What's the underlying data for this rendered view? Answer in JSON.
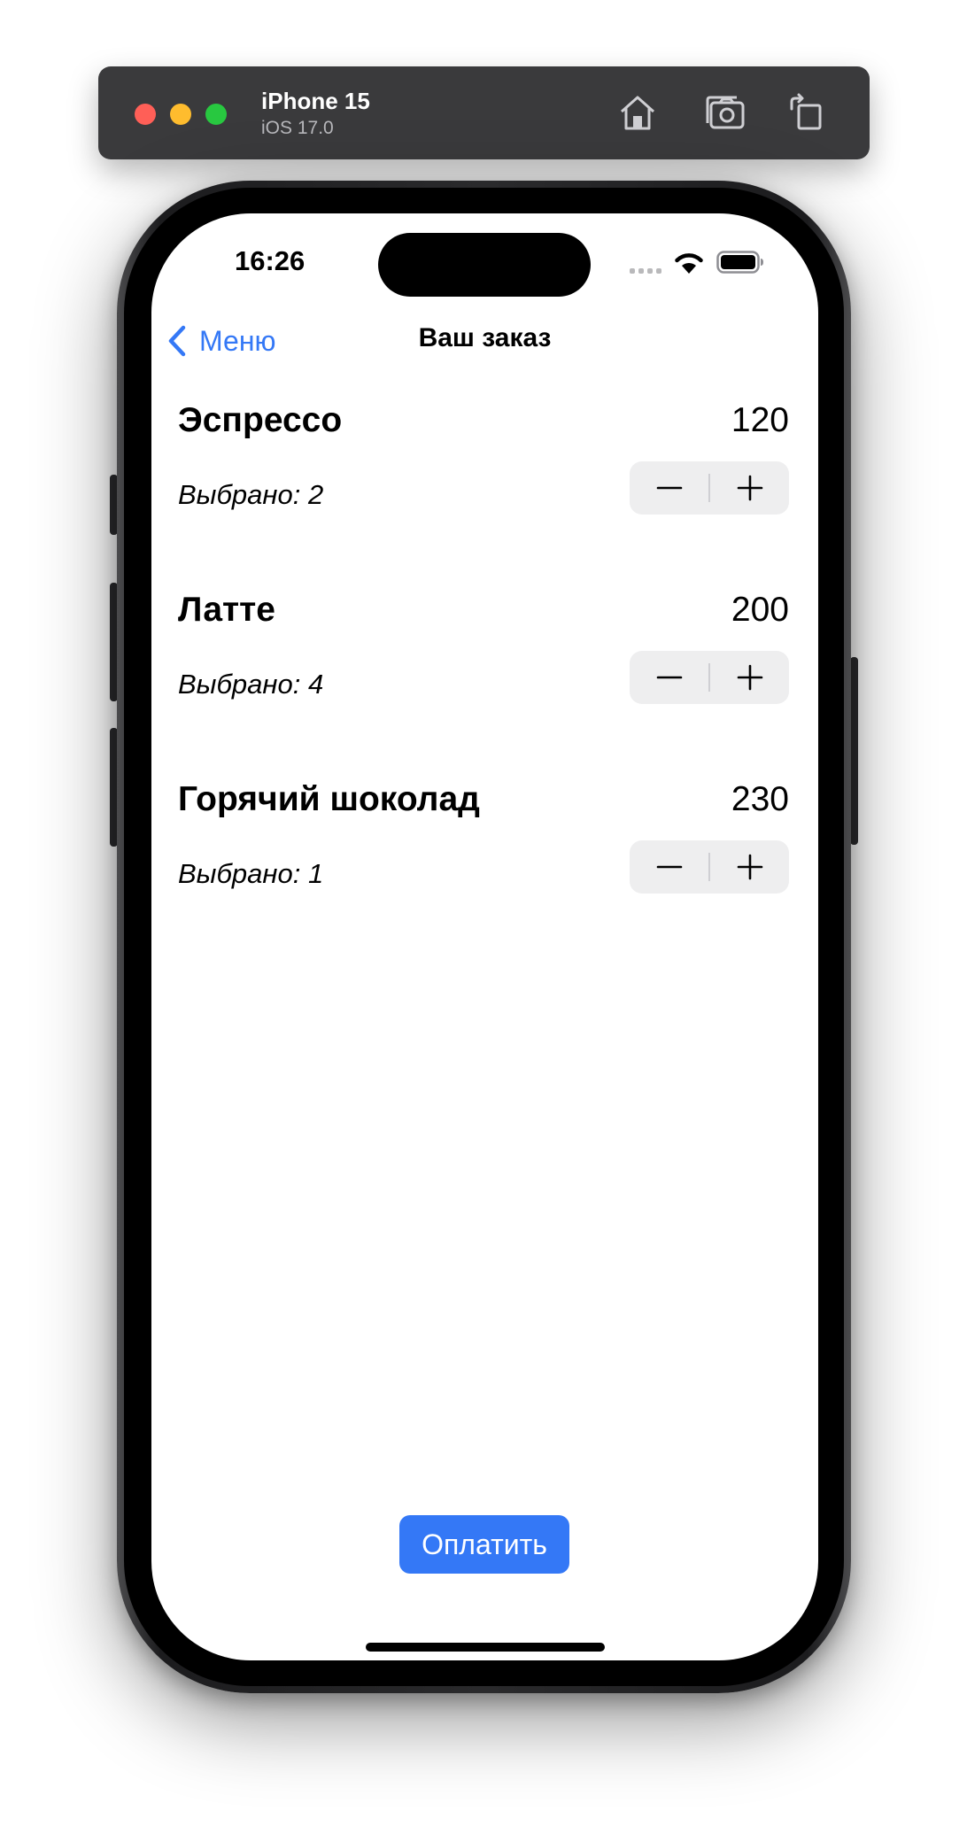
{
  "simulator": {
    "device_name": "iPhone 15",
    "os_version": "iOS 17.0",
    "icons": [
      "home-icon",
      "screenshot-icon",
      "rotate-icon"
    ]
  },
  "status_bar": {
    "time": "16:26",
    "icons": [
      "cellular-signal-icon",
      "wifi-icon",
      "battery-icon"
    ]
  },
  "nav": {
    "back_label": "Меню",
    "title": "Ваш заказ"
  },
  "order": {
    "count_label": "Выбрано: ",
    "items": [
      {
        "name": "Эспрессо",
        "price": "120",
        "count": "2"
      },
      {
        "name": "Латте",
        "price": "200",
        "count": "4"
      },
      {
        "name": "Горячий шоколад",
        "price": "230",
        "count": "1"
      }
    ]
  },
  "actions": {
    "pay_label": "Оплатить"
  },
  "colors": {
    "accent": "#3478f6",
    "stepper_bg": "#eeeeef",
    "toolbar_bg": "#3a3a3c"
  }
}
